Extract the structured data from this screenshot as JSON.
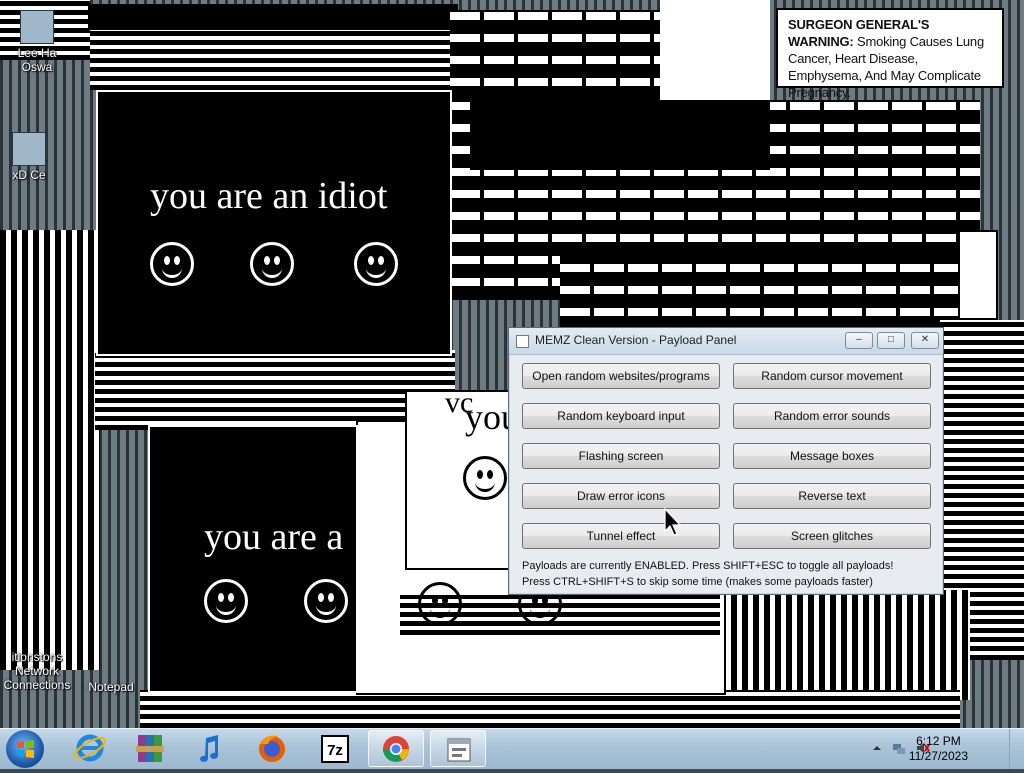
{
  "desktop": {
    "icons": [
      {
        "label": "Lee Ha Oswa"
      },
      {
        "label": "xD Ce"
      },
      {
        "label": "Network Connections"
      },
      {
        "label": "Notepad"
      },
      {
        "label": "itionstons"
      }
    ]
  },
  "warning": {
    "bold": "SURGEON GENERAL'S WARNING:",
    "text": " Smoking Causes Lung Cancer, Heart Disease, Emphysema, And May Complicate Pregnancy."
  },
  "idiot_windows": [
    {
      "text": "you are an idiot"
    },
    {
      "text": "you are a"
    },
    {
      "text": "you"
    },
    {
      "text": "vc"
    }
  ],
  "memz": {
    "title": "MEMZ Clean Version - Payload Panel",
    "buttons": [
      "Open random websites/programs",
      "Random cursor movement",
      "Random keyboard input",
      "Random error sounds",
      "Flashing screen",
      "Message boxes",
      "Draw error icons",
      "Reverse text",
      "Tunnel effect",
      "Screen glitches"
    ],
    "info_line1": "Payloads are currently ENABLED. Press SHIFT+ESC to toggle all payloads!",
    "info_line2": "Press CTRL+SHIFT+S to skip some time (makes some payloads faster)"
  },
  "taskbar": {
    "apps": [
      "Internet Explorer",
      "WinRAR",
      "iTunes",
      "Firefox",
      "7-Zip",
      "Chrome",
      "MEMZ"
    ],
    "time": "6:12 PM",
    "date": "11/27/2023"
  },
  "colors": {
    "taskbar": "#a9c3d8",
    "window_bg": "#e8ecf0"
  }
}
